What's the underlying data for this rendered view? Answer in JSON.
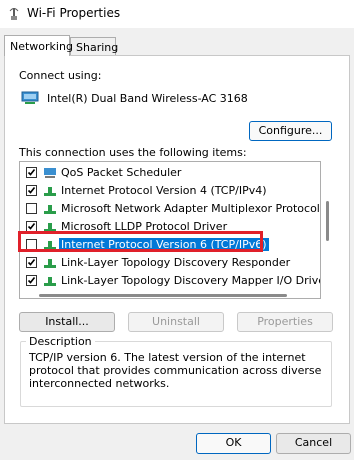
{
  "window": {
    "title": "Wi-Fi Properties"
  },
  "tabs": [
    {
      "label": "Networking",
      "active": true
    },
    {
      "label": "Sharing",
      "active": false
    }
  ],
  "connect_using": {
    "label": "Connect using:",
    "adapter": "Intel(R) Dual Band Wireless-AC 3168",
    "icon": "network-adapter-icon",
    "configure_label": "Configure..."
  },
  "items_label": "This connection uses the following items:",
  "items": [
    {
      "label": "QoS Packet Scheduler",
      "checked": true,
      "icon": "qos-scheduler-icon"
    },
    {
      "label": "Internet Protocol Version 4 (TCP/IPv4)",
      "checked": true,
      "icon": "protocol-icon"
    },
    {
      "label": "Microsoft Network Adapter Multiplexor Protocol",
      "checked": false,
      "icon": "protocol-icon"
    },
    {
      "label": "Microsoft LLDP Protocol Driver",
      "checked": true,
      "icon": "protocol-icon"
    },
    {
      "label": "Internet Protocol Version 6 (TCP/IPv6)",
      "checked": false,
      "icon": "protocol-icon",
      "selected": true
    },
    {
      "label": "Link-Layer Topology Discovery Responder",
      "checked": true,
      "icon": "protocol-icon"
    },
    {
      "label": "Link-Layer Topology Discovery Mapper I/O Driver",
      "checked": true,
      "icon": "protocol-icon"
    }
  ],
  "buttons": {
    "install": "Install...",
    "uninstall": "Uninstall",
    "properties": "Properties",
    "ok": "OK",
    "cancel": "Cancel"
  },
  "description": {
    "title": "Description",
    "text": "TCP/IP version 6. The latest version of the internet protocol that provides communication across diverse interconnected networks."
  },
  "colors": {
    "selection": "#0078d7",
    "highlight_border": "#e0202a",
    "accent": "#0067c0"
  }
}
